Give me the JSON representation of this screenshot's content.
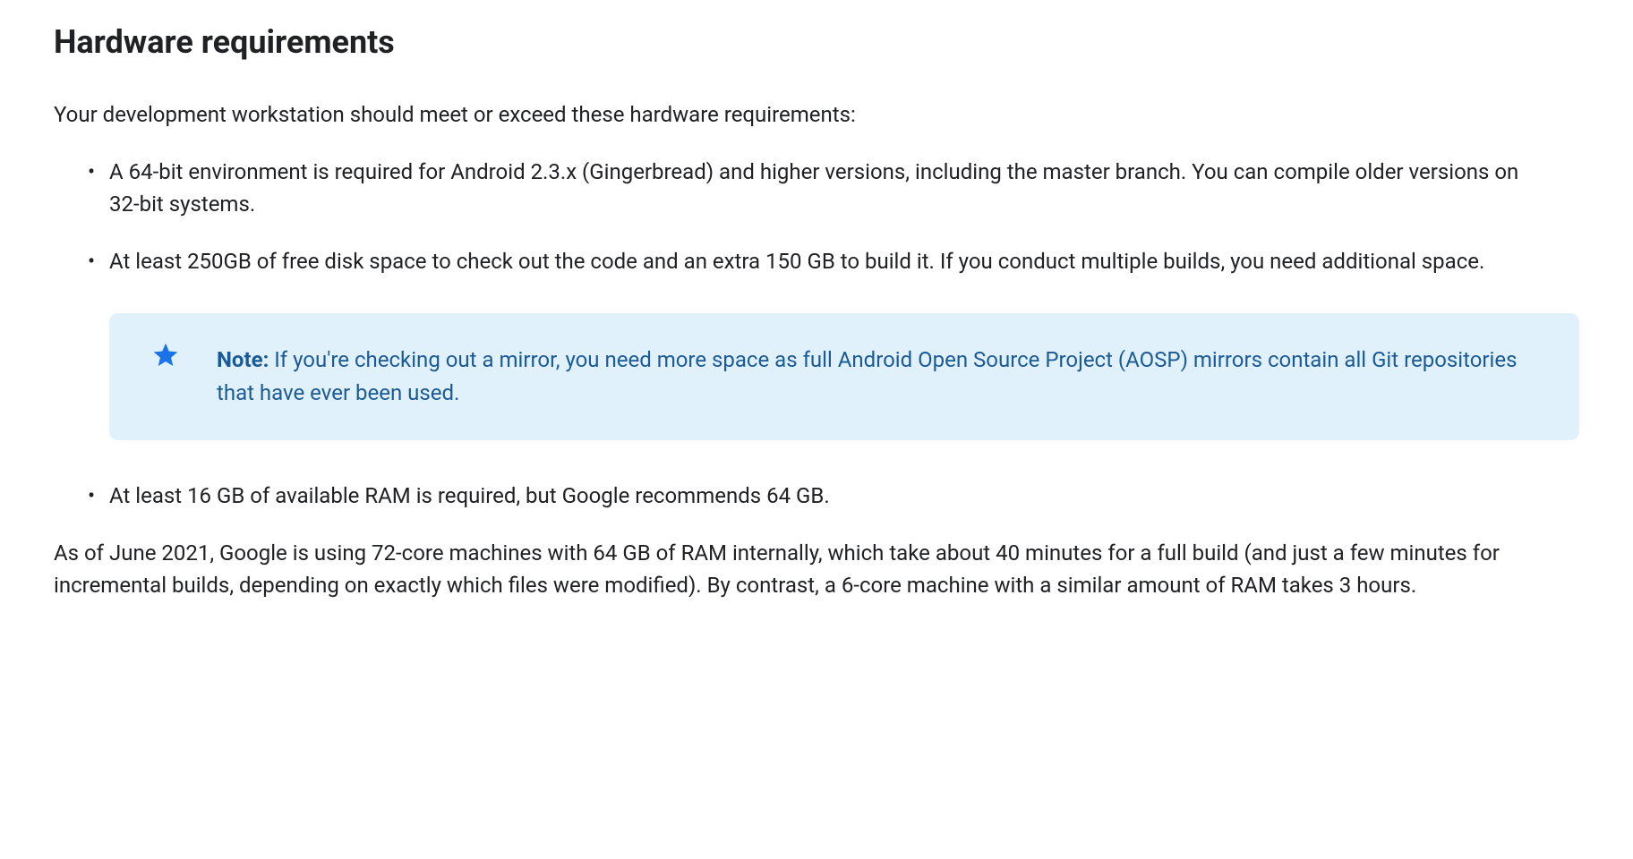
{
  "heading": "Hardware requirements",
  "intro": "Your development workstation should meet or exceed these hardware requirements:",
  "bullets_top": [
    "A 64-bit environment is required for Android 2.3.x (Gingerbread) and higher versions, including the master branch. You can compile older versions on 32-bit systems.",
    "At least 250GB of free disk space to check out the code and an extra 150 GB to build it. If you conduct multiple builds, you need additional space."
  ],
  "note": {
    "label": "Note:",
    "text": " If you're checking out a mirror, you need more space as full Android Open Source Project (AOSP) mirrors contain all Git repositories that have ever been used."
  },
  "bullets_bottom": [
    "At least 16 GB of available RAM is required, but Google recommends 64 GB."
  ],
  "closing": "As of June 2021, Google is using 72-core machines with 64 GB of RAM internally, which take about 40 minutes for a full build (and just a few minutes for incremental builds, depending on exactly which files were modified). By contrast, a 6-core machine with a similar amount of RAM takes 3 hours."
}
